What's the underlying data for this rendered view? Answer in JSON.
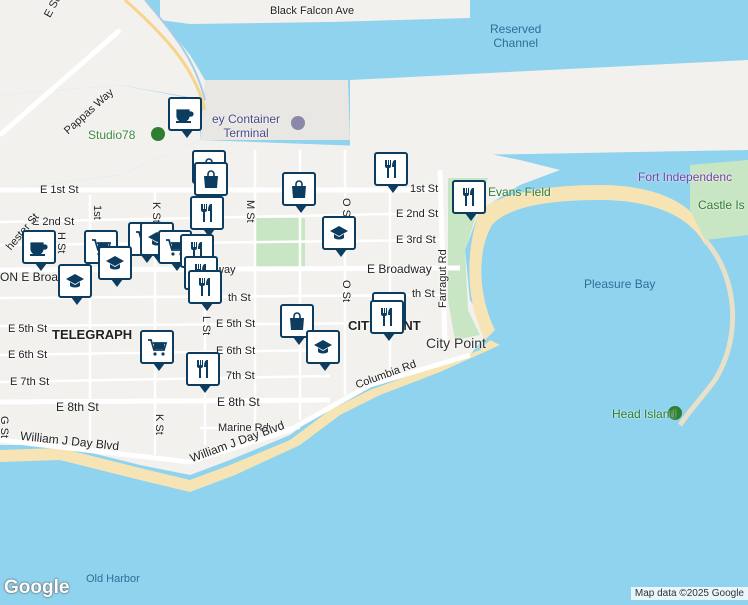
{
  "map": {
    "streets": [
      {
        "id": "black-falcon",
        "label": "Black Falcon Ave"
      },
      {
        "id": "e-1st-west",
        "label": "E 1st St"
      },
      {
        "id": "e-1st-east",
        "label": "1st St"
      },
      {
        "id": "e-2nd-west",
        "label": "E 2nd St"
      },
      {
        "id": "e-2nd-east",
        "label": "E 2nd St"
      },
      {
        "id": "e-3rd-east",
        "label": "E 3rd St"
      },
      {
        "id": "e-broadway",
        "label": "E Broadway"
      },
      {
        "id": "e-broadway-frag",
        "label": "way"
      },
      {
        "id": "e-brc",
        "label": "ON E Broa"
      },
      {
        "id": "e-4th-frag",
        "label": "th St"
      },
      {
        "id": "e-4th-east",
        "label": "th St"
      },
      {
        "id": "e-5th-west",
        "label": "E 5th St"
      },
      {
        "id": "e-5th-mid",
        "label": "E 5th St"
      },
      {
        "id": "e-6th-west",
        "label": "E 6th St"
      },
      {
        "id": "e-6th-mid",
        "label": "E 6th St"
      },
      {
        "id": "e-7th-west",
        "label": "E 7th St"
      },
      {
        "id": "e-7th-mid",
        "label": "7th St"
      },
      {
        "id": "e-8th-west",
        "label": "E 8th St"
      },
      {
        "id": "e-8th-mid",
        "label": "E 8th St"
      },
      {
        "id": "marine-rd",
        "label": "Marine Rd"
      },
      {
        "id": "wjd-1",
        "label": "William J Day Blvd"
      },
      {
        "id": "wjd-2",
        "label": "William J Day Blvd"
      },
      {
        "id": "columbia",
        "label": "Columbia Rd"
      },
      {
        "id": "farragut",
        "label": "Farragut Rd"
      },
      {
        "id": "pappas",
        "label": "Pappas Way"
      },
      {
        "id": "e-st",
        "label": "E St"
      },
      {
        "id": "dorchester",
        "label": "hester St"
      },
      {
        "id": "m-st",
        "label": "M St"
      },
      {
        "id": "o-st-n",
        "label": "O St"
      },
      {
        "id": "o-st-s",
        "label": "O St"
      },
      {
        "id": "k-st-n",
        "label": "K St"
      },
      {
        "id": "k-st-s",
        "label": "K St"
      },
      {
        "id": "l-st",
        "label": "L St"
      },
      {
        "id": "first-st",
        "label": "1st"
      },
      {
        "id": "h-st",
        "label": "H St"
      },
      {
        "id": "g-st",
        "label": "G St"
      }
    ],
    "water": [
      {
        "id": "reserved-channel",
        "label": "Reserved\nChannel"
      },
      {
        "id": "pleasure-bay",
        "label": "Pleasure Bay"
      },
      {
        "id": "old-harbor",
        "label": "Old Harbor"
      }
    ],
    "places": [
      {
        "id": "container-terminal",
        "label": "ey Container\nTerminal"
      },
      {
        "id": "studio78",
        "label": "Studio78"
      },
      {
        "id": "evans-field",
        "label": "Evans Field"
      },
      {
        "id": "fort-independence",
        "label": "Fort Independenc"
      },
      {
        "id": "castle-island",
        "label": "Castle Is"
      },
      {
        "id": "head-island",
        "label": "Head Island"
      },
      {
        "id": "city-point-road",
        "label": "City Point"
      },
      {
        "id": "city-point-area",
        "label": "CITY POINT"
      },
      {
        "id": "telegraph",
        "label": "TELEGRAPH"
      }
    ],
    "colors": {
      "water": "#8fd3ef",
      "land": "#f2f1ee",
      "park": "#c9e6c4",
      "beach": "#f7e4b5",
      "pin_border": "#0d3c61",
      "pin_fill": "#ffffff"
    }
  },
  "pins": [
    {
      "icon": "coffee-icon"
    },
    {
      "icon": "shopping-bag-icon"
    },
    {
      "icon": "shopping-bag-icon"
    },
    {
      "icon": "restaurant-icon"
    },
    {
      "icon": "restaurant-icon"
    },
    {
      "icon": "restaurant-icon"
    },
    {
      "icon": "school-icon"
    },
    {
      "icon": "shopping-bag-icon"
    },
    {
      "icon": "restaurant-icon"
    },
    {
      "icon": "restaurant-icon"
    },
    {
      "icon": "school-icon"
    },
    {
      "icon": "grocery-cart-icon"
    },
    {
      "icon": "restaurant-icon"
    },
    {
      "icon": "coffee-icon"
    },
    {
      "icon": "school-icon"
    },
    {
      "icon": "grocery-cart-icon"
    },
    {
      "icon": "school-icon"
    },
    {
      "icon": "restaurant-icon"
    },
    {
      "icon": "restaurant-icon"
    },
    {
      "icon": "grocery-cart-icon"
    }
  ],
  "footer": {
    "logo": "Google",
    "attribution": "Map data ©2025 Google"
  }
}
